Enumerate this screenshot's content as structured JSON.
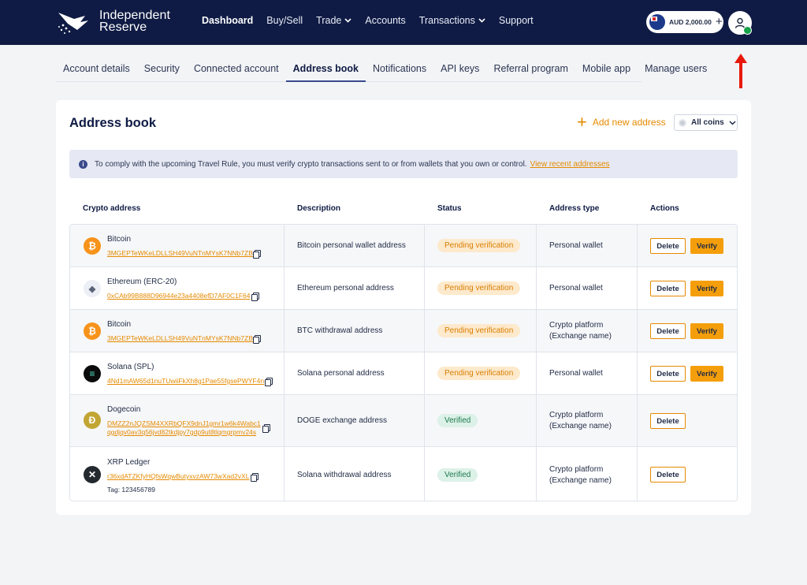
{
  "header": {
    "logo_line1": "Independent",
    "logo_line2": "Reserve",
    "nav": [
      "Dashboard",
      "Buy/Sell",
      "Trade",
      "Accounts",
      "Transactions",
      "Support"
    ],
    "balance": "AUD 2,000.00",
    "balance_plus": "+"
  },
  "subtabs": [
    "Account details",
    "Security",
    "Connected account",
    "Address book",
    "Notifications",
    "API keys",
    "Referral program",
    "Mobile app",
    "Manage users"
  ],
  "page": {
    "title": "Address book",
    "add_label": "Add new address",
    "add_plus": "+",
    "coins_filter": "All coins",
    "notice_text": "To comply with the upcoming Travel Rule, you must verify crypto transactions sent to or from wallets that you own or control.",
    "notice_link": "View recent addresses",
    "info_glyph": "i"
  },
  "table": {
    "headers": [
      "Crypto address",
      "Description",
      "Status",
      "Address type",
      "Actions"
    ],
    "rows": [
      {
        "coin": "Bitcoin",
        "glyph": "₿",
        "address": "3MGEPTeWKeLDLLSH49VuNTnMYsK7NNb7ZB",
        "description": "Bitcoin personal wallet address",
        "status": "Pending verification",
        "type1": "Personal wallet",
        "type2": "",
        "delete": "Delete",
        "verify": "Verify"
      },
      {
        "coin": "Ethereum (ERC-20)",
        "glyph": "◆",
        "address": "0xCAb99B888D96944e23a4408efD7AF0C1F64",
        "description": "Ethereum personal address",
        "status": "Pending verification",
        "type1": "Personal wallet",
        "type2": "",
        "delete": "Delete",
        "verify": "Verify"
      },
      {
        "coin": "Bitcoin",
        "glyph": "₿",
        "address": "3MGEPTeWKeLDLLSH49VuNTnMYsK7NNb7ZB",
        "description": "BTC withdrawal address",
        "status": "Pending verification",
        "type1": "Crypto platform",
        "type2": "(Exchange name)",
        "delete": "Delete",
        "verify": "Verify"
      },
      {
        "coin": "Solana (SPL)",
        "glyph": "≡",
        "address": "4Nd1mAW65d1nuTUwiiFkXh8g1Pae55fgsePWYF4n",
        "description": "Solana personal address",
        "status": "Pending verification",
        "type1": "Personal wallet",
        "type2": "",
        "delete": "Delete",
        "verify": "Verify"
      },
      {
        "coin": "Dogecoin",
        "glyph": "Ð",
        "address": "DMZZ2nJQZSM4XXRbQFX9dnJ1gmr1w6k4Wabc1",
        "address2": "qgdjqv0av3q56jvd82tkdjpy7gdp9ut8tlqmgrpmv24s",
        "description": "DOGE exchange address",
        "status": "Verified",
        "type1": "Crypto platform",
        "type2": "(Exchange name)",
        "delete": "Delete",
        "verify": ""
      },
      {
        "coin": "XRP Ledger",
        "glyph": "✕",
        "address": "r36xdATZKfyHQfsWqwButyxvzAW73wXad2vXL",
        "tag": "Tag: 123456789",
        "description": "Solana withdrawal address",
        "status": "Verified",
        "type1": "Crypto platform",
        "type2": "(Exchange name)",
        "delete": "Delete",
        "verify": ""
      }
    ]
  },
  "colors": {
    "nav_bg": "#0f1b44",
    "accent": "#e58a00",
    "verify_bg": "#f59e0b",
    "pending_bg": "#fde9cc",
    "verified_bg": "#dcf1e7",
    "annotation_arrow": "#e8190b"
  }
}
